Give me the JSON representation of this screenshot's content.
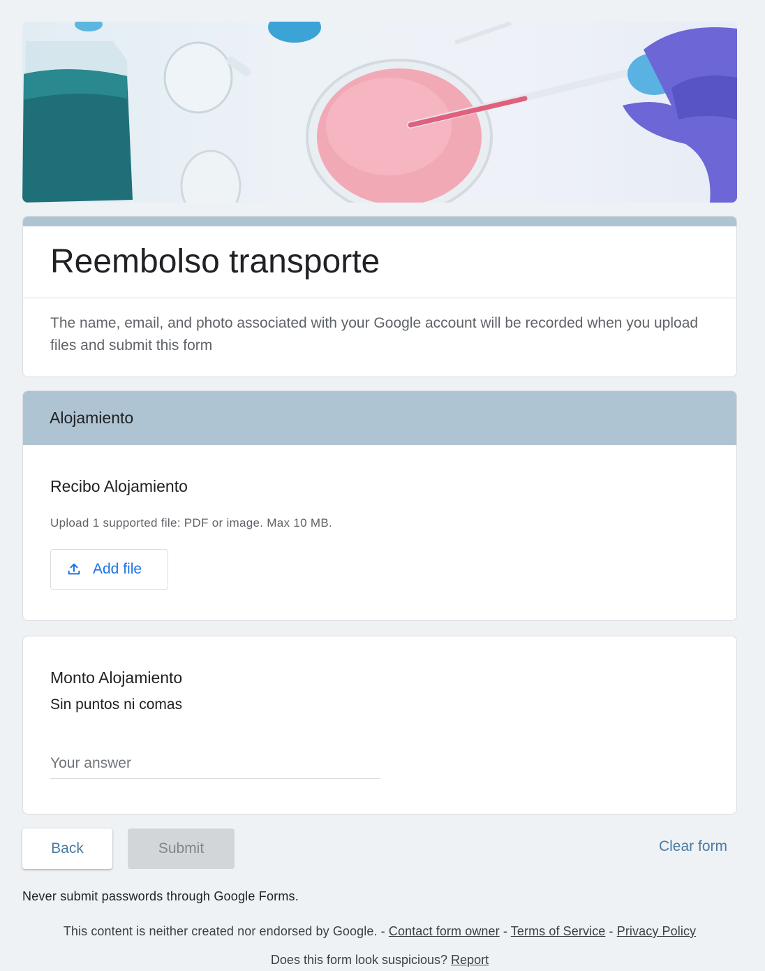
{
  "banner": {
    "alt": "lab glassware with pink petri dish and pipette"
  },
  "form": {
    "title": "Reembolso transporte",
    "notice": "The name, email, and photo associated with your Google account will be recorded when you upload files and submit this form"
  },
  "section": {
    "title": "Alojamiento",
    "upload_question": {
      "title": "Recibo Alojamiento",
      "help": "Upload 1 supported file: PDF or image. Max 10 MB.",
      "button_label": "Add file",
      "button_icon": "upload-icon"
    }
  },
  "amount_question": {
    "title": "Monto Alojamiento",
    "description": "Sin puntos ni comas",
    "placeholder": "Your answer",
    "value": ""
  },
  "actions": {
    "back_label": "Back",
    "submit_label": "Submit",
    "clear_label": "Clear form"
  },
  "footer": {
    "password_warning": "Never submit passwords through Google Forms.",
    "disclaimer_text": "This content is neither created nor endorsed by Google. -",
    "sep": "-",
    "contact_link": "Contact form owner",
    "terms_link": "Terms of Service",
    "privacy_link": "Privacy Policy",
    "suspicious_text": "Does this form look suspicious?",
    "report_link": "Report"
  },
  "colors": {
    "accent": "#aec4d3",
    "link_blue": "#1a73e8",
    "button_text": "#4a7ba4",
    "background": "#eef2f5"
  }
}
